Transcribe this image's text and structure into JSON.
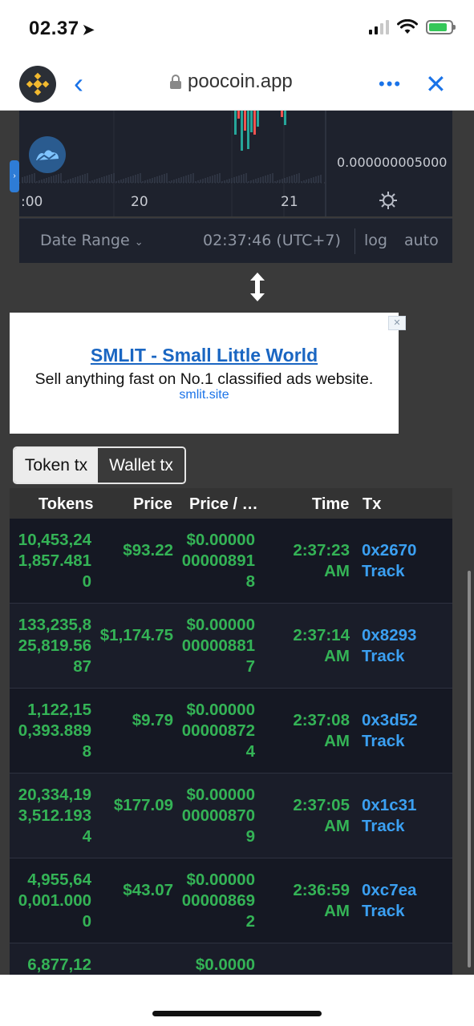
{
  "status": {
    "time": "02.37",
    "signal_bars": 4,
    "signal_active": 2,
    "battery_charging": true
  },
  "browser": {
    "url": "poocoin.app",
    "more": "•••",
    "back": "‹",
    "close": "✕"
  },
  "chart": {
    "time_labels": [
      ":00",
      "20",
      "21"
    ],
    "price_label": "0.000000005000",
    "toolbar": {
      "date_range": "Date Range",
      "clock": "02:37:46 (UTC+7)",
      "log": "log",
      "auto": "auto"
    }
  },
  "ad": {
    "title": "SMLIT - Small Little World",
    "description": "Sell anything fast on No.1 classified ads website.",
    "url": "smlit.site",
    "close": "✕"
  },
  "tabs": [
    {
      "label": "Token tx",
      "active": true
    },
    {
      "label": "Wallet tx",
      "active": false
    }
  ],
  "table": {
    "headers": {
      "tokens": "Tokens",
      "price": "Price",
      "price_per_token": "Price / …",
      "time": "Time",
      "tx": "Tx"
    },
    "rows": [
      {
        "tokens": "10,453,241,857.4810",
        "price": "$93.22",
        "price_per_token": "$0.00000000008918",
        "time": "2:37:23 AM",
        "tx": "0x2670",
        "track": "Track"
      },
      {
        "tokens": "133,235,825,819.5687",
        "price": "$1,174.75",
        "price_per_token": "$0.00000000008817",
        "time": "2:37:14 AM",
        "tx": "0x8293",
        "track": "Track"
      },
      {
        "tokens": "1,122,150,393.8898",
        "price": "$9.79",
        "price_per_token": "$0.00000000008724",
        "time": "2:37:08 AM",
        "tx": "0x3d52",
        "track": "Track"
      },
      {
        "tokens": "20,334,193,512.1934",
        "price": "$177.09",
        "price_per_token": "$0.00000000008709",
        "time": "2:37:05 AM",
        "tx": "0x1c31",
        "track": "Track"
      },
      {
        "tokens": "4,955,640,001.0000",
        "price": "$43.07",
        "price_per_token": "$0.00000000008692",
        "time": "2:36:59 AM",
        "tx": "0xc7ea",
        "track": "Track"
      },
      {
        "tokens": "6,877,12",
        "price": "",
        "price_per_token": "$0.0000",
        "time": "",
        "tx": "",
        "track": ""
      }
    ]
  },
  "colors": {
    "buy_green": "#34b356",
    "link_blue": "#3ba0f2",
    "accent_ios_blue": "#1a73e8"
  }
}
